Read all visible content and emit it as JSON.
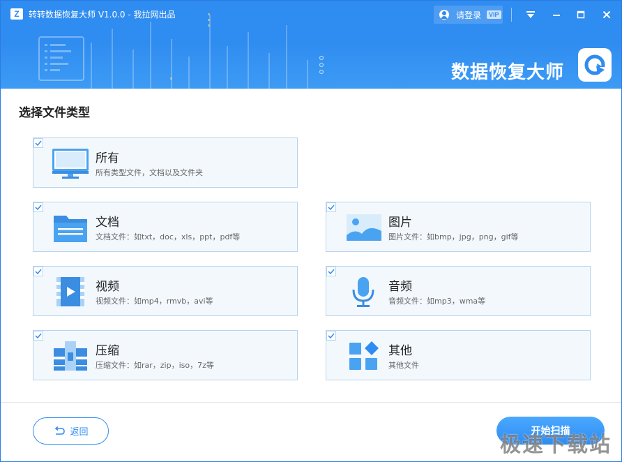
{
  "window": {
    "title": "转转数据恢复大师 V1.0.0 - 我拉网出品",
    "logo_letter": "Z",
    "login_label": "请登录",
    "vip_badge": "VIP",
    "brand_text": "数据恢复大师"
  },
  "main": {
    "section_title": "选择文件类型",
    "file_types": [
      {
        "key": "all",
        "label": "所有",
        "desc": "所有类型文件，文档以及文件夹",
        "icon": "monitor-icon",
        "checked": true
      },
      {
        "key": "documents",
        "label": "文档",
        "desc": "文档文件：如txt，doc，xls，ppt，pdf等",
        "icon": "folder-icon",
        "checked": true
      },
      {
        "key": "images",
        "label": "图片",
        "desc": "图片文件：如bmp，jpg，png，gif等",
        "icon": "image-icon",
        "checked": true
      },
      {
        "key": "videos",
        "label": "视频",
        "desc": "视频文件：如mp4，rmvb，avi等",
        "icon": "video-icon",
        "checked": true
      },
      {
        "key": "audio",
        "label": "音频",
        "desc": "音频文件：如mp3，wma等",
        "icon": "microphone-icon",
        "checked": true
      },
      {
        "key": "archives",
        "label": "压缩",
        "desc": "压缩文件：如rar，zip，iso，7z等",
        "icon": "archive-icon",
        "checked": true
      },
      {
        "key": "other",
        "label": "其他",
        "desc": "其他文件",
        "icon": "grid-icon",
        "checked": true
      }
    ]
  },
  "footer": {
    "back_label": "返回",
    "scan_label": "开始扫描"
  },
  "watermark": "极速下载站",
  "colors": {
    "accent": "#2f8cf0",
    "card_bg": "#f3f8fd",
    "card_border": "#b9d4ee"
  }
}
